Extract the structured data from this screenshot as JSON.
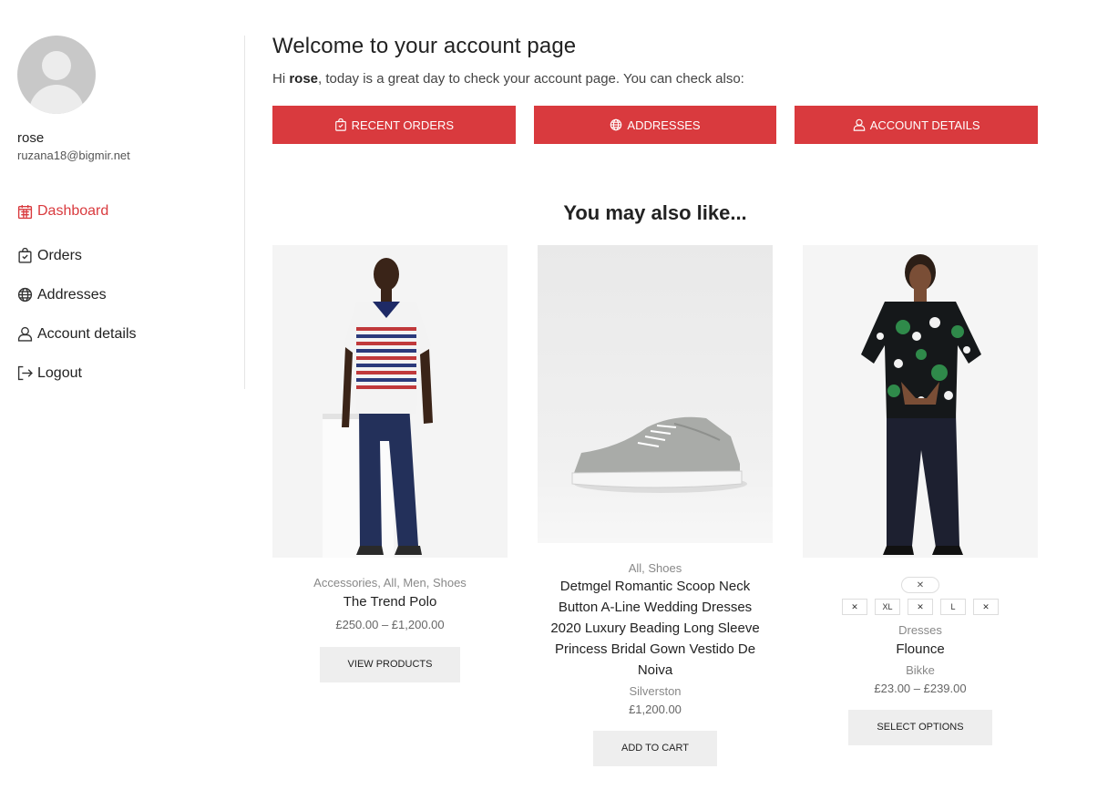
{
  "user": {
    "name": "rose",
    "email": "ruzana18@bigmir.net"
  },
  "nav": [
    {
      "label": "Dashboard",
      "icon": "calendar-icon",
      "active": true
    },
    {
      "label": "Orders",
      "icon": "bag-icon",
      "active": false
    },
    {
      "label": "Addresses",
      "icon": "globe-icon",
      "active": false
    },
    {
      "label": "Account details",
      "icon": "user-icon",
      "active": false
    },
    {
      "label": "Logout",
      "icon": "logout-icon",
      "active": false
    }
  ],
  "welcome": {
    "title": "Welcome to your account page",
    "hi": "Hi ",
    "name": "rose",
    "message": ", today is a great day to check your account page. You can check also:"
  },
  "quick_links": [
    {
      "label": "RECENT ORDERS",
      "icon": "bag-icon"
    },
    {
      "label": "ADDRESSES",
      "icon": "globe-icon"
    },
    {
      "label": "ACCOUNT DETAILS",
      "icon": "user-icon"
    }
  ],
  "recommend": {
    "title": "You may also like...",
    "products": [
      {
        "categories": "Accessories, All, Men, Shoes",
        "title": "The Trend Polo",
        "price": "£250.00 – £1,200.00",
        "button": "VIEW PRODUCTS"
      },
      {
        "categories": "All, Shoes",
        "title": "Detmgel Romantic Scoop Neck Button A-Line Wedding Dresses 2020 Luxury Beading Long Sleeve Princess Bridal Gown Vestido De Noiva",
        "brand": "Silverston",
        "price": "£1,200.00",
        "button": "ADD TO CART"
      },
      {
        "swatches": [
          "",
          "XL",
          "",
          "L",
          ""
        ],
        "categories": "Dresses",
        "title": "Flounce",
        "brand": "Bikke",
        "price": "£23.00 – £239.00",
        "button": "SELECT OPTIONS"
      }
    ]
  },
  "colors": {
    "accent": "#d93a3e",
    "button_grey": "#eeeeee"
  }
}
